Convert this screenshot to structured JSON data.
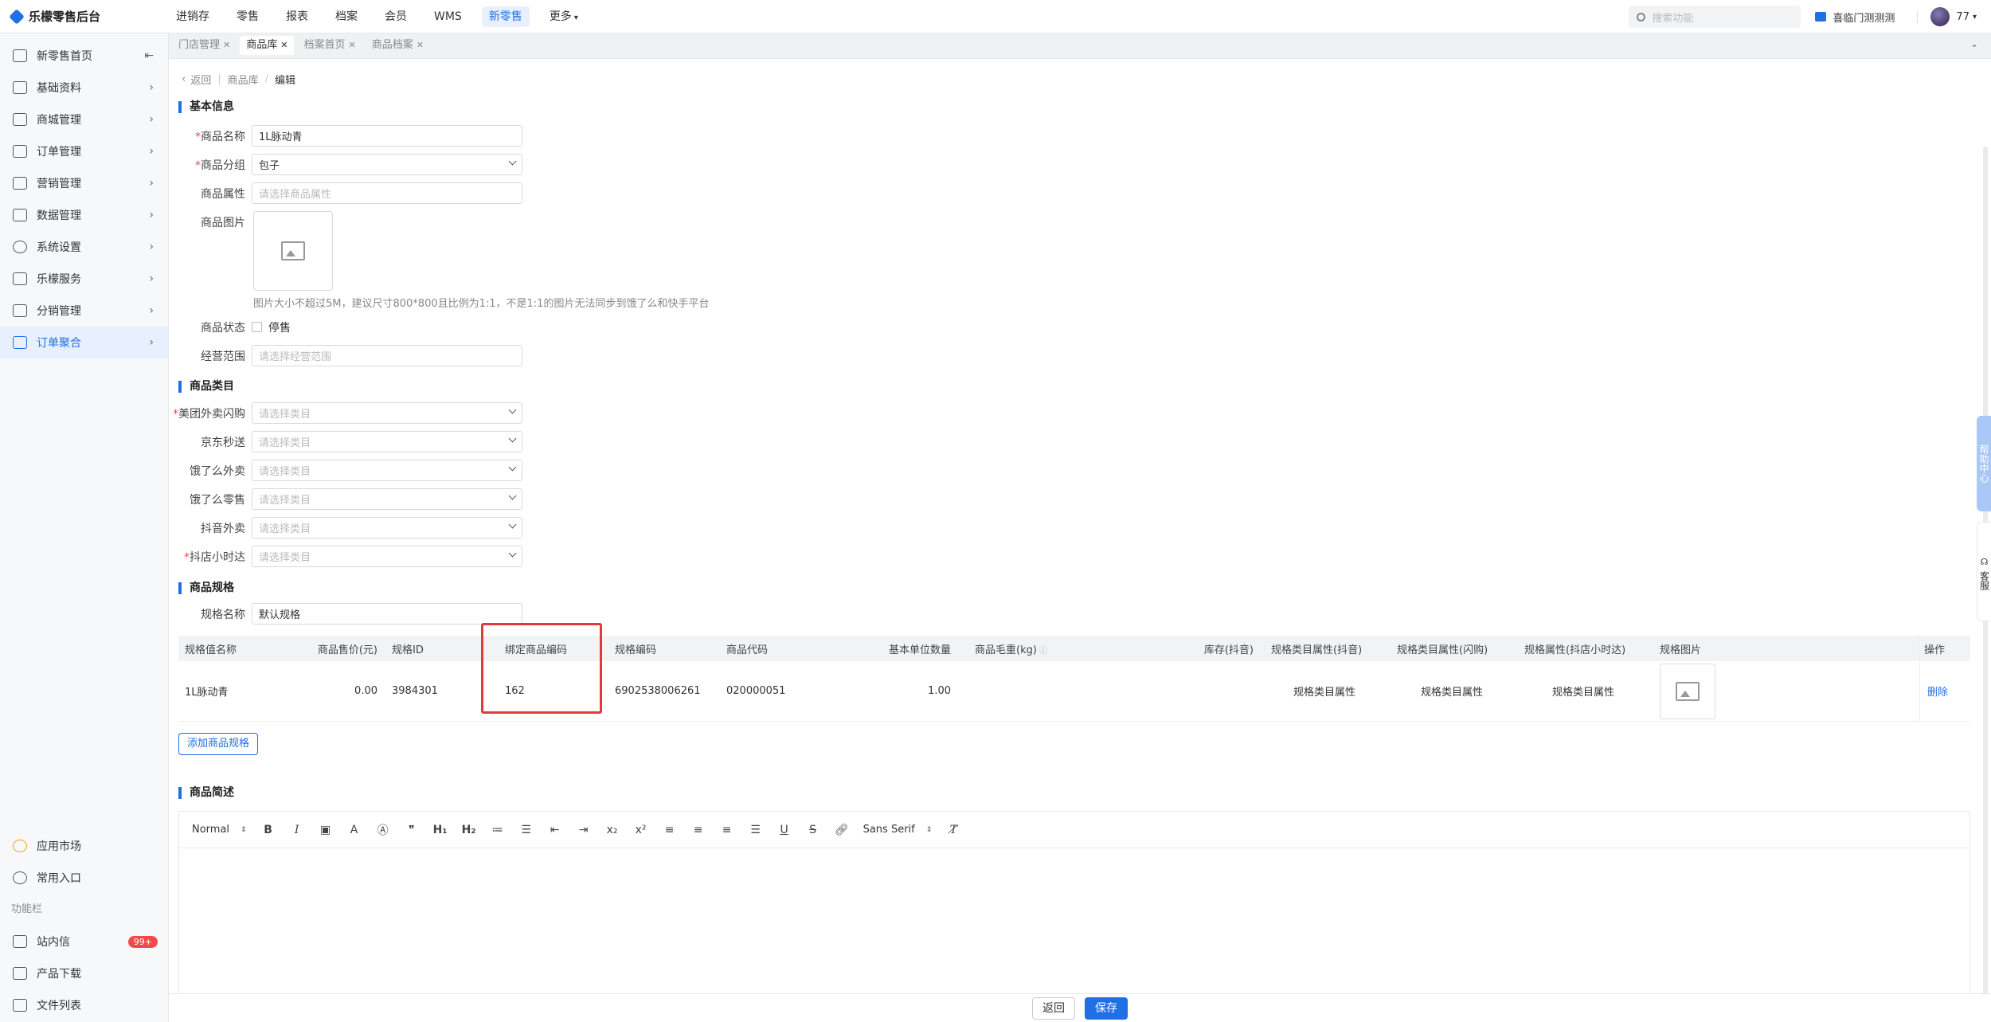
{
  "app": {
    "title": "乐檬零售后台"
  },
  "topnav": [
    "进销存",
    "零售",
    "报表",
    "档案",
    "会员",
    "WMS",
    "新零售",
    "更多"
  ],
  "top_right": {
    "search_placeholder": "搜索功能",
    "store": "喜临门测测测",
    "user": "77"
  },
  "sidebar": {
    "items": [
      {
        "label": "新零售首页",
        "icon": "home-icon"
      },
      {
        "label": "基础资料",
        "icon": "grid-icon"
      },
      {
        "label": "商城管理",
        "icon": "shop-icon"
      },
      {
        "label": "订单管理",
        "icon": "document-icon"
      },
      {
        "label": "营销管理",
        "icon": "marketing-icon"
      },
      {
        "label": "数据管理",
        "icon": "chart-icon"
      },
      {
        "label": "系统设置",
        "icon": "gear-icon"
      },
      {
        "label": "乐檬服务",
        "icon": "briefcase-icon"
      },
      {
        "label": "分销管理",
        "icon": "distribution-icon"
      },
      {
        "label": "订单聚合",
        "icon": "aggregate-icon"
      }
    ],
    "bottom": {
      "app_market": "应用市场",
      "favorites": "常用入口",
      "toolbar_label": "功能栏",
      "inbox": "站内信",
      "inbox_badge": "99+",
      "downloads": "产品下载",
      "files": "文件列表"
    }
  },
  "tabs": [
    "门店管理",
    "商品库",
    "档案首页",
    "商品档案"
  ],
  "breadcrumb": {
    "back": "返回",
    "parent": "商品库",
    "current": "编辑"
  },
  "basic": {
    "title": "基本信息",
    "name_label": "商品名称",
    "name_value": "1L脉动青",
    "group_label": "商品分组",
    "group_value": "包子",
    "attr_label": "商品属性",
    "attr_placeholder": "请选择商品属性",
    "image_label": "商品图片",
    "image_hint": "图片大小不超过5M，建议尺寸800*800且比例为1:1，不是1:1的图片无法同步到饿了么和快手平台",
    "status_label": "商品状态",
    "status_option": "停售",
    "scope_label": "经营范围",
    "scope_placeholder": "请选择经营范围"
  },
  "category": {
    "title": "商品类目",
    "placeholder": "请选择类目",
    "rows": [
      "美团外卖闪购",
      "京东秒送",
      "饿了么外卖",
      "饿了么零售",
      "抖音外卖",
      "抖店小时达"
    ]
  },
  "spec": {
    "title": "商品规格",
    "name_label": "规格名称",
    "name_value": "默认规格",
    "columns": [
      "规格值名称",
      "商品售价(元)",
      "规格ID",
      "绑定商品编码",
      "规格编码",
      "商品代码",
      "基本单位数量",
      "商品毛重(kg)",
      "库存(抖音)",
      "规格类目属性(抖音)",
      "规格类目属性(闪购)",
      "规格属性(抖店小时达)",
      "规格图片",
      "操作"
    ],
    "row": {
      "spec_value": "1L脉动青",
      "price": "0.00",
      "spec_id": "3984301",
      "bind_code": "162",
      "spec_code": "6902538006261",
      "goods_code": "020000051",
      "unit_qty": "1.00",
      "attr_douyin": "规格类目属性",
      "attr_shangou": "规格类目属性",
      "attr_xiaoshida": "规格类目属性",
      "delete": "删除"
    },
    "add_button": "添加商品规格"
  },
  "desc": {
    "title": "商品简述",
    "format": "Normal",
    "font": "Sans Serif"
  },
  "footer": {
    "back": "返回",
    "save": "保存"
  },
  "float": {
    "help": "帮助中心",
    "service": "客服"
  },
  "colors": {
    "accent": "#1f6fe5",
    "highlight": "#e23a3a",
    "badge": "#f04a4a"
  }
}
